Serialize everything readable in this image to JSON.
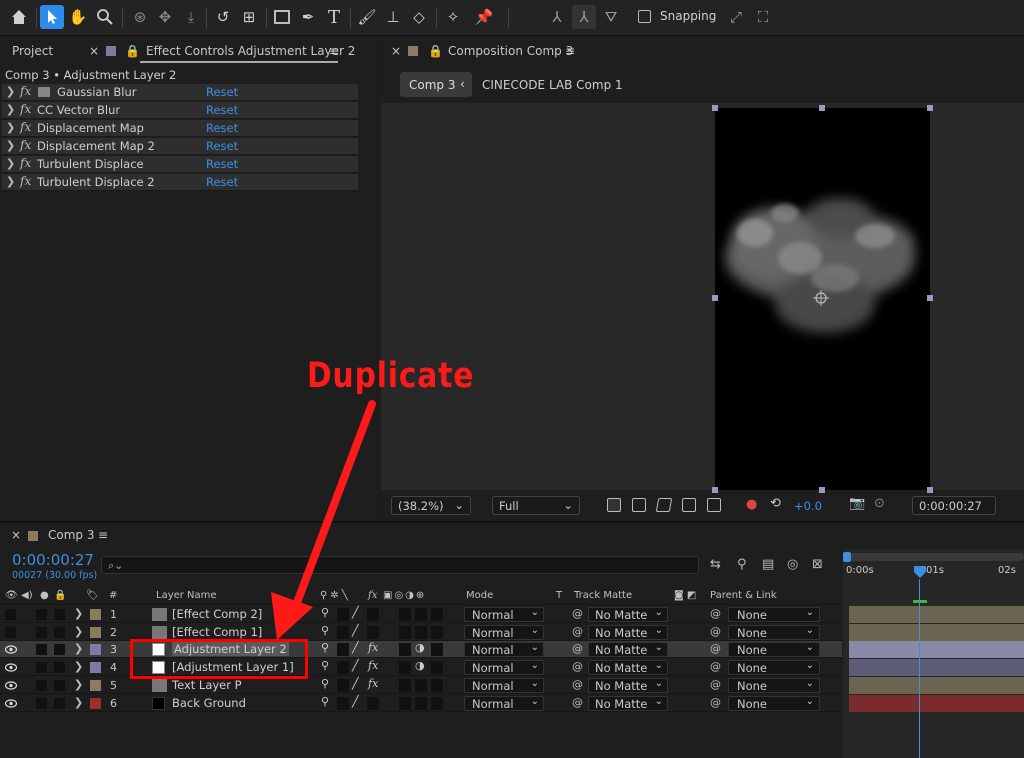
{
  "toolbar": {
    "snapping_label": "Snapping",
    "tools": [
      "home-icon",
      "selection-tool-icon",
      "hand-tool-icon",
      "zoom-tool-icon",
      "orbit-camera-icon",
      "pan-camera-icon",
      "dolly-camera-icon",
      "rotation-tool-icon",
      "pan-behind-icon",
      "rectangle-tool-icon",
      "pen-tool-icon",
      "type-tool-icon",
      "brush-tool-icon",
      "clone-stamp-icon",
      "eraser-tool-icon",
      "roto-brush-icon",
      "puppet-pin-icon"
    ]
  },
  "left_panel": {
    "tab_project": "Project",
    "tab_effect_controls": "Effect Controls Adjustment Layer 2",
    "path": "Comp 3 • Adjustment Layer 2",
    "fx_symbol": "fx",
    "effects": [
      {
        "name": "Gaussian Blur",
        "reset": "Reset"
      },
      {
        "name": "CC Vector Blur",
        "reset": "Reset"
      },
      {
        "name": "Displacement Map",
        "reset": "Reset"
      },
      {
        "name": "Displacement Map 2",
        "reset": "Reset"
      },
      {
        "name": "Turbulent Displace",
        "reset": "Reset"
      },
      {
        "name": "Turbulent Displace 2",
        "reset": "Reset"
      }
    ]
  },
  "comp_panel": {
    "tab_title": "Composition Comp 3",
    "crumb_active": "Comp 3",
    "crumb_other": "CINECODE LAB Comp 1",
    "zoom": "(38.2%)",
    "resolution": "Full",
    "exposure": "+0.0",
    "timecode": "0:00:00:27"
  },
  "timeline": {
    "tab_title": "Comp 3",
    "current_time": "0:00:00:27",
    "frames": "00027 (30.00 fps)",
    "headers": {
      "hash": "#",
      "layer_name": "Layer Name",
      "mode": "Mode",
      "t": "T",
      "track_matte": "Track Matte",
      "parent": "Parent & Link"
    },
    "ruler": [
      "0:00s",
      "01s",
      "02s"
    ],
    "layers": [
      {
        "num": "1",
        "name": "[Effect Comp 2]",
        "mode": "Normal",
        "matte": "No Matte",
        "parent": "None",
        "label": "#8c7b60",
        "bar": "#6b6451"
      },
      {
        "num": "2",
        "name": "[Effect Comp 1]",
        "mode": "Normal",
        "matte": "No Matte",
        "parent": "None",
        "label": "#8c7b60",
        "bar": "#6b6451"
      },
      {
        "num": "3",
        "name": "Adjustment Layer 2",
        "mode": "Normal",
        "matte": "No Matte",
        "parent": "None",
        "label": "#7c7ca0",
        "bar": "#6d6d8f"
      },
      {
        "num": "4",
        "name": "[Adjustment Layer 1]",
        "mode": "Normal",
        "matte": "No Matte",
        "parent": "None",
        "label": "#7c7ca0",
        "bar": "#5d5d7a"
      },
      {
        "num": "5",
        "name": "Text Layer P",
        "mode": "Normal",
        "matte": "No Matte",
        "parent": "None",
        "label": "#8c7b60",
        "bar": "#6b6451"
      },
      {
        "num": "6",
        "name": "Back Ground",
        "mode": "Normal",
        "matte": "No Matte",
        "parent": "None",
        "label": "#9c2e2e",
        "bar": "#7a2c2c"
      }
    ]
  },
  "annotation": {
    "label": "Duplicate",
    "color": "#ff1a1a"
  }
}
